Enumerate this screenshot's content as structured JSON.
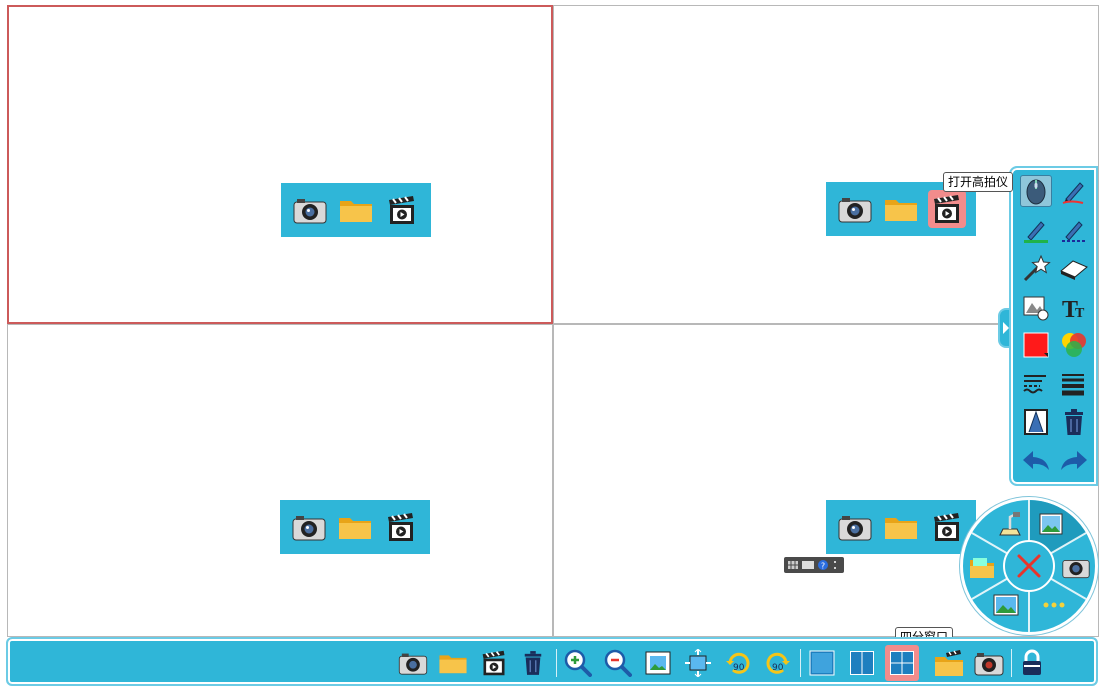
{
  "tooltips": {
    "capture_device": "打开高拍仪",
    "quad_view": "四分窗口"
  },
  "panes": [
    {
      "id": "pane-1",
      "active": true,
      "buttons": [
        "camera-icon",
        "folder-icon",
        "video-clapper-icon"
      ]
    },
    {
      "id": "pane-2",
      "active": false,
      "buttons": [
        "camera-icon",
        "folder-icon",
        "video-clapper-icon"
      ]
    },
    {
      "id": "pane-3",
      "active": false,
      "buttons": [
        "camera-icon",
        "folder-icon",
        "video-clapper-icon"
      ]
    },
    {
      "id": "pane-4",
      "active": false,
      "buttons": [
        "camera-icon",
        "folder-icon",
        "video-clapper-icon"
      ]
    }
  ],
  "right_toolbar": {
    "selected_tool": "mouse-pointer-icon",
    "tools": [
      "mouse-pointer-icon",
      "pen-icon",
      "highlighter-icon",
      "laser-pen-icon",
      "magic-wand-icon",
      "eraser-icon",
      "shape-icon",
      "text-icon",
      "color-red-icon",
      "color-palette-icon",
      "line-style-icon",
      "line-width-icon",
      "projector-icon",
      "trash-icon",
      "undo-icon",
      "redo-icon"
    ]
  },
  "bottom_toolbar": {
    "buttons": [
      "camera-icon",
      "folder-icon",
      "video-clapper-icon",
      "trash-icon",
      "zoom-in-icon",
      "zoom-out-icon",
      "fit-window-icon",
      "actual-size-icon",
      "rotate-left-90-icon",
      "rotate-right-90-icon",
      "single-view-icon",
      "dual-view-icon",
      "quad-view-icon",
      "folder-video-icon",
      "camera-settings-icon",
      "lock-icon"
    ],
    "selected": "quad-view-icon"
  },
  "radial_menu": {
    "items": [
      "document-camera-icon",
      "image-gallery-icon",
      "folder-open-icon",
      "camera-icon",
      "picture-icon",
      "more-icon"
    ],
    "center": "close-icon"
  },
  "colors": {
    "accent": "#2fb6d8",
    "active_border": "#cc5a5a",
    "highlight": "#f28c8c"
  }
}
